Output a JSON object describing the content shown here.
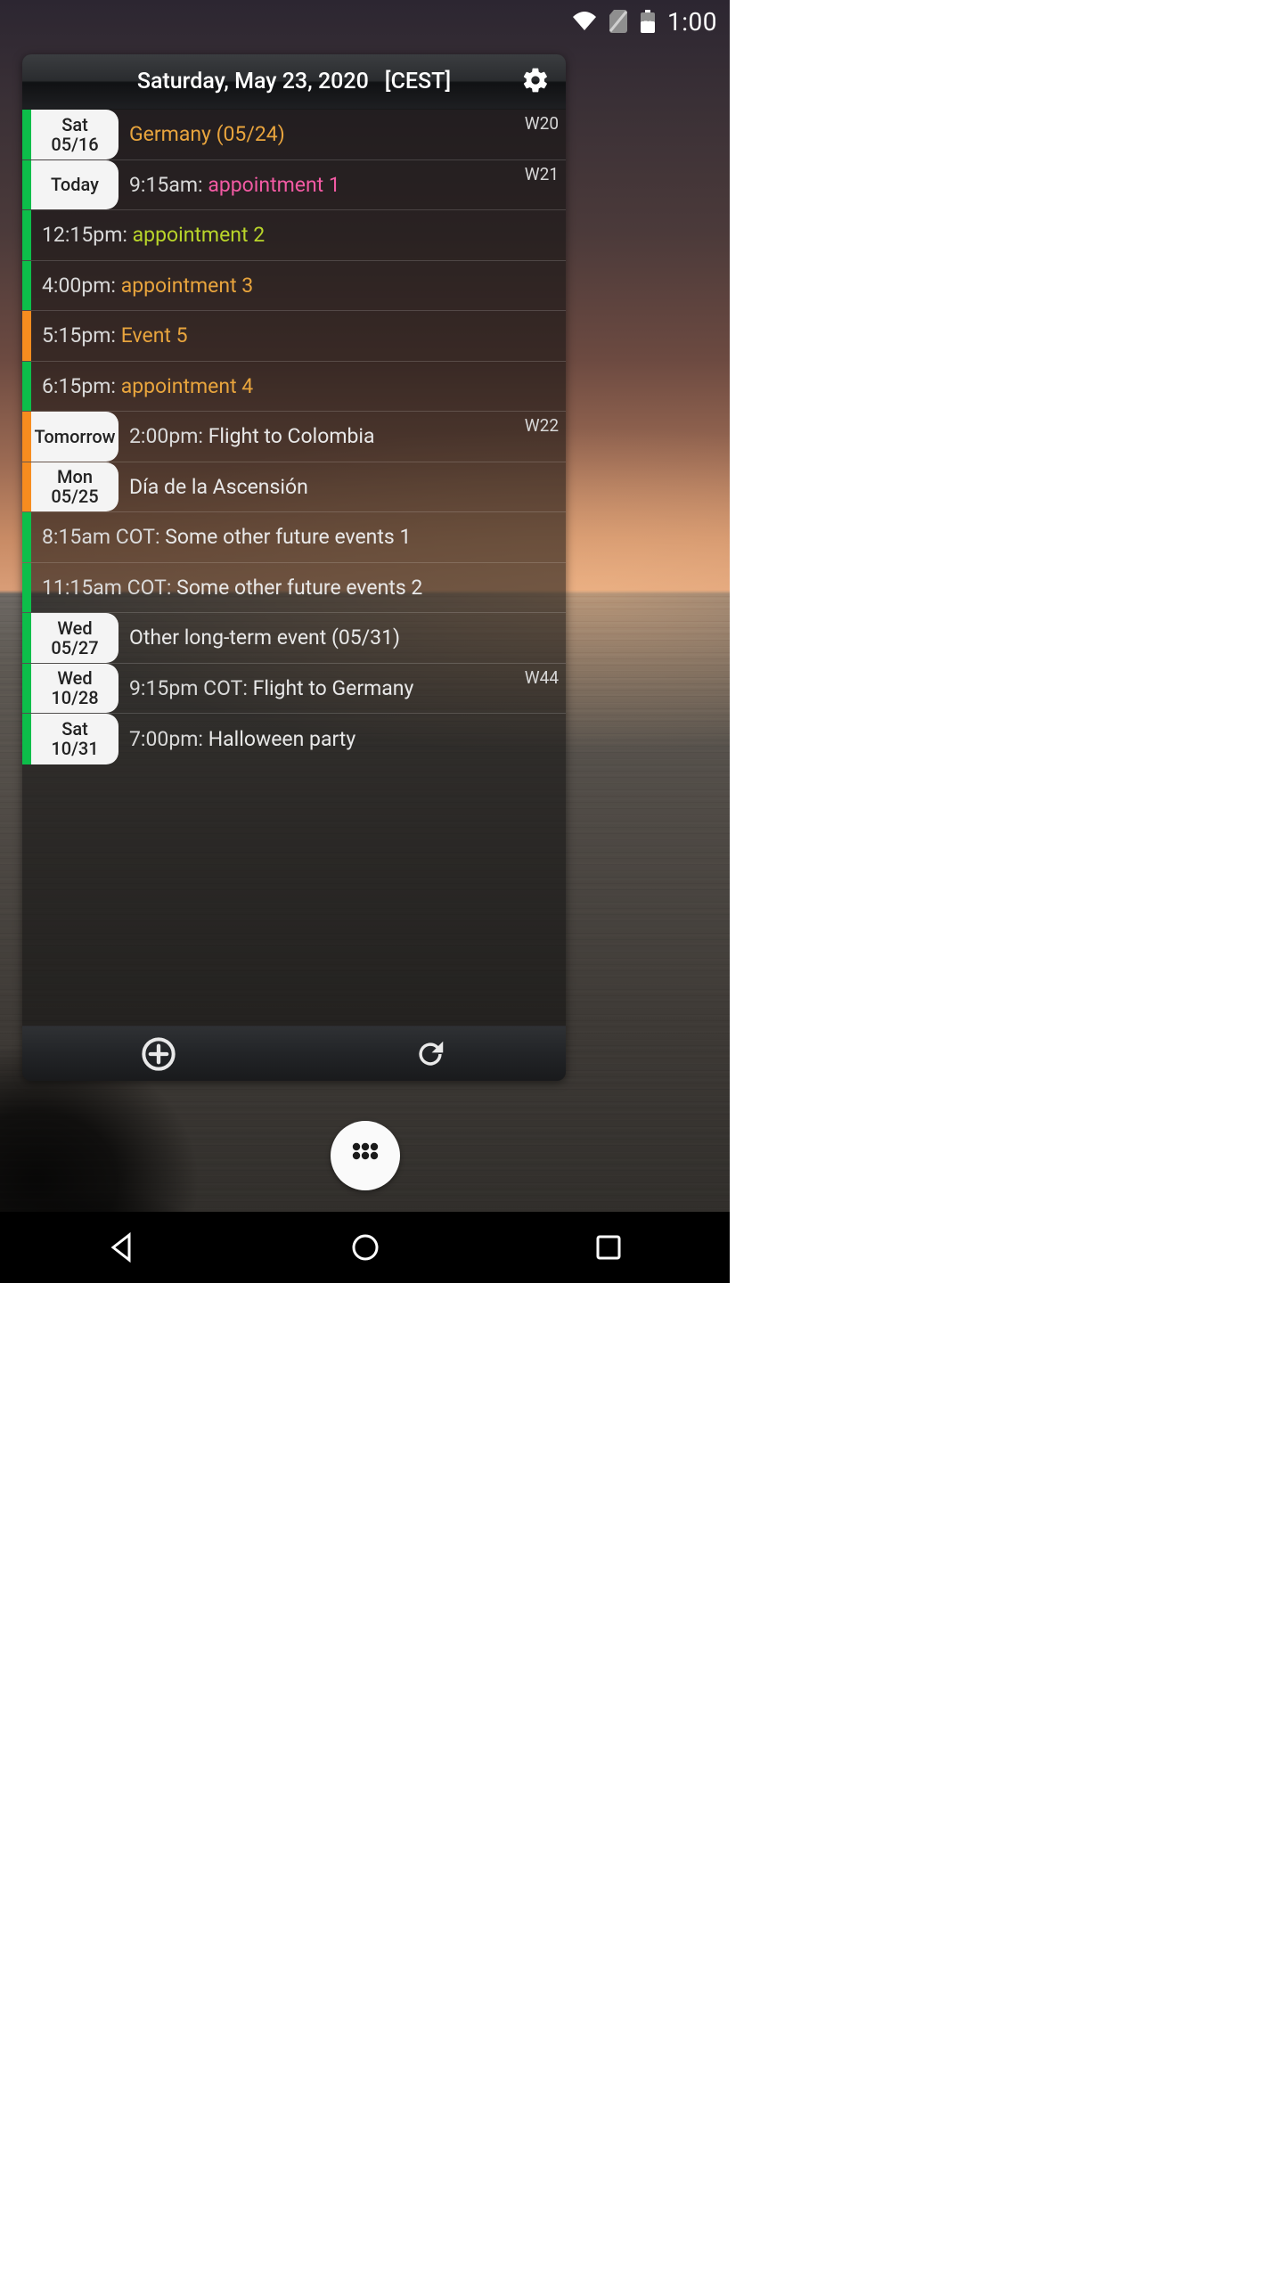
{
  "status": {
    "time": "1:00",
    "battery_pct": "58"
  },
  "widget": {
    "header_date": "Saturday, May 23, 2020",
    "header_tz": "[CEST]"
  },
  "colors": {
    "green": "#0DBE4A",
    "orange": "#F78C1F",
    "white": "#E8E8E8",
    "time": "#D9D9D9",
    "pink": "#F25AA3",
    "yellowgreen": "#B9D52A",
    "amber": "#E8A43D"
  },
  "rows": [
    {
      "stripe": "green",
      "date_l1": "Sat",
      "date_l2": "05/16",
      "time": "",
      "title": "Germany (05/24)",
      "title_color": "amber",
      "week": "W20"
    },
    {
      "stripe": "green",
      "date_l1": "Today",
      "date_l2": "",
      "time": "9:15am: ",
      "title": "appointment 1",
      "title_color": "pink",
      "week": "W21"
    },
    {
      "stripe": "green",
      "date_l1": "",
      "date_l2": "",
      "time": "12:15pm: ",
      "title": "appointment 2",
      "title_color": "yellowgreen",
      "week": ""
    },
    {
      "stripe": "green",
      "date_l1": "",
      "date_l2": "",
      "time": "4:00pm: ",
      "title": "appointment 3",
      "title_color": "amber",
      "week": ""
    },
    {
      "stripe": "orange",
      "date_l1": "",
      "date_l2": "",
      "time": "5:15pm: ",
      "title": "Event 5",
      "title_color": "amber",
      "week": ""
    },
    {
      "stripe": "green",
      "date_l1": "",
      "date_l2": "",
      "time": "6:15pm: ",
      "title": "appointment 4",
      "title_color": "amber",
      "week": ""
    },
    {
      "stripe": "orange",
      "date_l1": "Tomorrow",
      "date_l2": "",
      "time": "2:00pm: ",
      "title": "Flight to Colombia",
      "title_color": "white",
      "week": "W22"
    },
    {
      "stripe": "orange",
      "date_l1": "Mon",
      "date_l2": "05/25",
      "time": "",
      "title": "Día de la Ascensión",
      "title_color": "white",
      "week": ""
    },
    {
      "stripe": "green",
      "date_l1": "",
      "date_l2": "",
      "time": "8:15am COT: ",
      "title": "Some other future events 1",
      "title_color": "white",
      "week": ""
    },
    {
      "stripe": "green",
      "date_l1": "",
      "date_l2": "",
      "time": "11:15am COT: ",
      "title": "Some other future events 2",
      "title_color": "white",
      "week": ""
    },
    {
      "stripe": "green",
      "date_l1": "Wed",
      "date_l2": "05/27",
      "time": "",
      "title": "Other long-term event (05/31)",
      "title_color": "white",
      "week": ""
    },
    {
      "stripe": "green",
      "date_l1": "Wed",
      "date_l2": "10/28",
      "time": "9:15pm COT: ",
      "title": "Flight to Germany",
      "title_color": "white",
      "week": "W44"
    },
    {
      "stripe": "green",
      "date_l1": "Sat",
      "date_l2": "10/31",
      "time": "7:00pm: ",
      "title": "Halloween party",
      "title_color": "white",
      "week": ""
    }
  ]
}
